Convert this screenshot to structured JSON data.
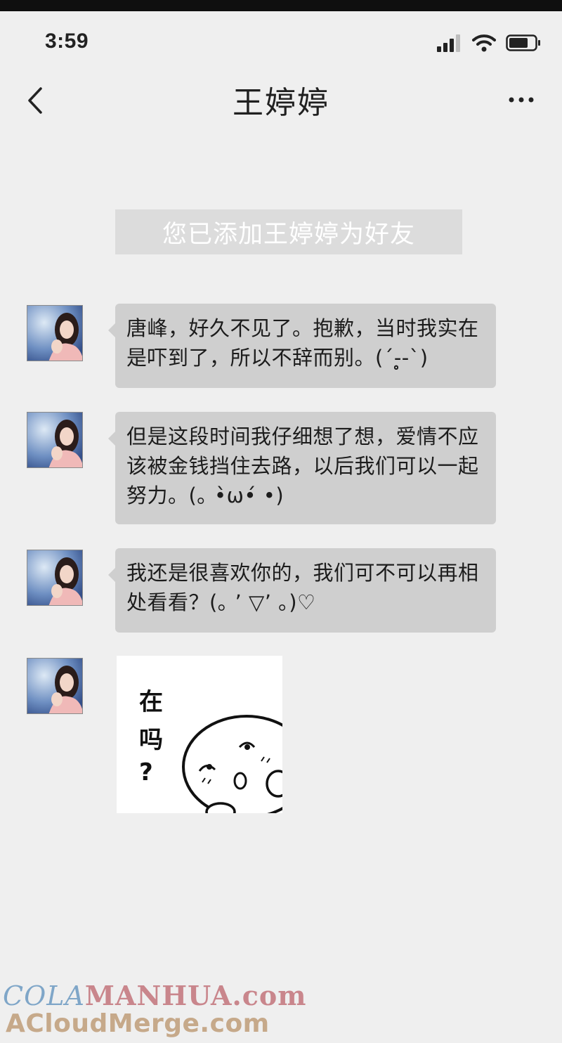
{
  "status_bar": {
    "time": "3:59"
  },
  "nav": {
    "title": "王婷婷"
  },
  "system_notice": "您已添加王婷婷为好友",
  "messages": [
    {
      "sender": "王婷婷",
      "text": "唐峰，好久不见了。抱歉，当时我实在是吓到了，所以不辞而别。(´-̥̥̥-`)"
    },
    {
      "sender": "王婷婷",
      "text": "但是这段时间我仔细想了想，爱情不应该被金钱挡住去路，以后我们可以一起努力。(｡ •̀ω•́ •)"
    },
    {
      "sender": "王婷婷",
      "text": "我还是很喜欢你的，我们可不可以再相处看看？(｡ ’ ▽’ ｡)♡"
    }
  ],
  "sticker": {
    "lines": [
      "在",
      "吗",
      "?"
    ]
  },
  "watermark": {
    "part1": "COLA",
    "part2": "MANHUA.com",
    "line2": "ACloudMerge.com"
  }
}
